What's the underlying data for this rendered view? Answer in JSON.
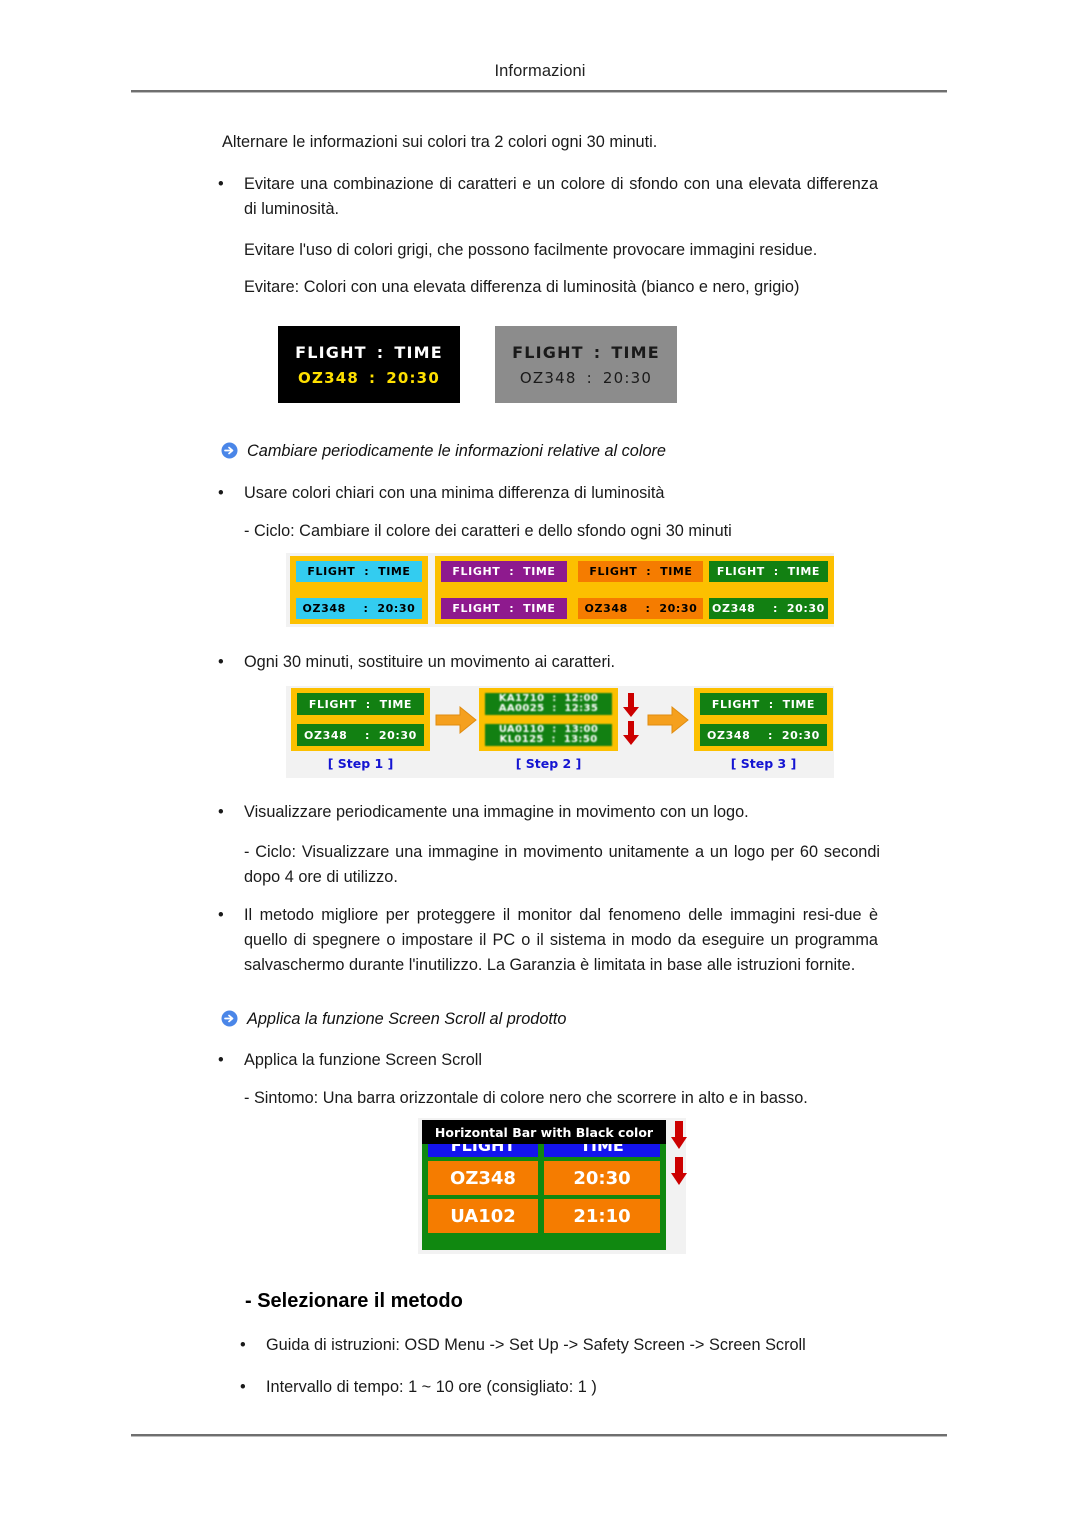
{
  "header": {
    "title": "Informazioni"
  },
  "intro": {
    "line": "Alternare le informazioni sui colori tra 2 colori ogni 30 minuti."
  },
  "bullets": {
    "b1": "Evitare una combinazione di caratteri e un colore di sfondo con una elevata differenza di luminosità.",
    "b1_dot": "•",
    "sub1": "Evitare l'uso di colori grigi, che possono facilmente provocare immagini residue.",
    "sub2": "Evitare: Colori con una elevata differenza di luminosità (bianco e nero, grigio)",
    "b2": "Usare colori chiari con una minima differenza di luminosità",
    "sub3": "- Ciclo: Cambiare il colore dei caratteri e dello sfondo ogni 30 minuti",
    "b3": "Ogni 30 minuti, sostituire un movimento ai caratteri.",
    "b4": "Visualizzare periodicamente una immagine in movimento con un logo.",
    "sub4": "- Ciclo: Visualizzare una immagine in movimento unitamente a un logo per 60 secondi dopo 4 ore di utilizzo.",
    "b5": "Il metodo migliore per proteggere il monitor dal fenomeno delle immagini resi-due è quello di spegnere o impostare il PC o il sistema in modo da eseguire un programma salvaschermo durante l'inutilizzo. La Garanzia è limitata in base alle istruzioni fornite.",
    "b6": "Applica la funzione Screen Scroll",
    "sub5": "- Sintomo: Una barra orizzontale di colore nero che scorrere in alto e in basso.",
    "b7": "Guida di istruzioni: OSD Menu -> Set Up -> Safety Screen -> Screen Scroll",
    "b8": "Intervallo di tempo: 1 ~ 10 ore (consigliato: 1 )"
  },
  "headings": {
    "h1": "Cambiare periodicamente le informazioni relative al colore",
    "h2": "Applica la funzione Screen Scroll al prodotto",
    "h3": "- Selezionare il metodo"
  },
  "contrast_figure": {
    "black_panel": {
      "bg": "#000000",
      "row1_label": "FLIGHT",
      "row1_sep": ":",
      "row1_value": "TIME",
      "row1_color": "#ffffff",
      "row2_label": "OZ348",
      "row2_sep": ":",
      "row2_value": "20:30",
      "row2_color": "#ffe000"
    },
    "gray_panel": {
      "bg": "#8c8c8c",
      "row1_label": "FLIGHT",
      "row1_sep": ":",
      "row1_value": "TIME",
      "row1_color": "#1a1a1a",
      "row2_label": "OZ348",
      "row2_sep": ":",
      "row2_value": "20:30",
      "row2_color": "#1a1a1a"
    }
  },
  "color_cycle": {
    "frame_color": "#fcc000",
    "panels": [
      {
        "bg": "#33ccf0",
        "text_color": "#000000",
        "row1": "FLIGHT  :  TIME",
        "row2": "OZ348    :  20:30"
      },
      {
        "bg": "#8e1a8e",
        "text_color": "#ffffff",
        "row1": "FLIGHT  :  TIME",
        "row2": "FLIGHT  :  TIME"
      },
      {
        "bg": "#f57c00",
        "text_color": "#000000",
        "row1": "FLIGHT  :  TIME",
        "row2": "OZ348    :  20:30"
      },
      {
        "bg": "#128012",
        "text_color": "#ffffff",
        "row1": "FLIGHT  :  TIME",
        "row2": "OZ348    :  20:30"
      }
    ]
  },
  "steps_figure": {
    "frame_color": "#fcc000",
    "panel_bg": "#128012",
    "arrow_color": "#f5a01e",
    "red_arrow_color": "#cc0000",
    "step1": {
      "label": "[ Step 1 ]",
      "row1": "FLIGHT  :  TIME",
      "row2": "OZ348    :  20:30"
    },
    "step2": {
      "label": "[ Step 2 ]",
      "row1a": "KA1710  :  12:00",
      "row1b": "AA0025  :  12:35",
      "row2a": "UA0110  :  13:00",
      "row2b": "KL0125  :  13:50"
    },
    "step3": {
      "label": "[ Step 3 ]",
      "row1": "FLIGHT  :  TIME",
      "row2": "OZ348    :  20:30"
    }
  },
  "scroll_figure": {
    "bar_label": "Horizontal Bar with Black color",
    "bar_bg": "#000000",
    "bar_text_color": "#ffffff",
    "board_bg": "#108810",
    "header_bg": "#1414ee",
    "header_text_color": "#ffffff",
    "cell_bg": "#f57c00",
    "cell_text_color": "#ffffff",
    "arrow_color": "#cc0000",
    "header": [
      "FLIGHT",
      "TIME"
    ],
    "rows": [
      [
        "OZ348",
        "20:30"
      ],
      [
        "UA102",
        "21:10"
      ]
    ]
  }
}
